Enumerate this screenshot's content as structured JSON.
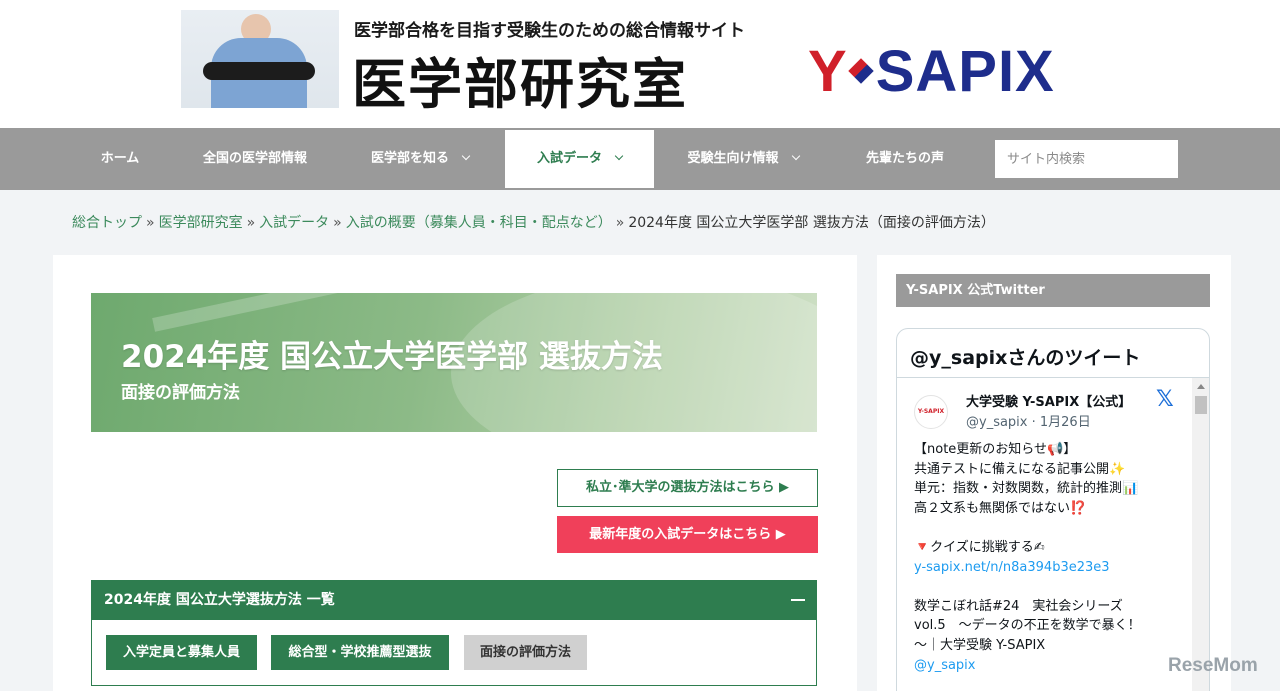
{
  "header": {
    "tagline": "医学部合格を目指す受験生のための総合情報サイト",
    "logo_text": "医学部研究室",
    "brand_y": "Y",
    "brand_rest": "SAPIX"
  },
  "nav": {
    "items": [
      {
        "label": "ホーム",
        "dropdown": false
      },
      {
        "label": "全国の医学部情報",
        "dropdown": false
      },
      {
        "label": "医学部を知る",
        "dropdown": true
      },
      {
        "label": "入試データ",
        "dropdown": true,
        "active": true
      },
      {
        "label": "受験生向け情報",
        "dropdown": true
      },
      {
        "label": "先輩たちの声",
        "dropdown": false
      }
    ],
    "search_placeholder": "サイト内検索"
  },
  "breadcrumb": {
    "items": [
      "総合トップ",
      "医学部研究室",
      "入試データ",
      "入試の概要（募集人員・科目・配点など）"
    ],
    "current": "2024年度 国公立大学医学部 選抜方法（面接の評価方法）",
    "separator": "»"
  },
  "main": {
    "banner_title": "2024年度 国公立大学医学部 選抜方法",
    "banner_subtitle": "面接の評価方法",
    "private_link": "私立･準大学の選抜方法はこちら ▶",
    "latest_link": "最新年度の入試データはこちら ▶",
    "accordion_title": "2024年度 国公立大学選抜方法 一覧",
    "tags": [
      "入学定員と募集人員",
      "総合型・学校推薦型選抜",
      "面接の評価方法"
    ]
  },
  "sidebar": {
    "heading": "Y-SAPIX 公式Twitter",
    "timeline_title": "@y_sapixさんのツイート",
    "tweet": {
      "avatar_text": "Y-SAPIX",
      "name": "大学受験 Y-SAPIX【公式】",
      "handle_date": "@y_sapix · 1月26日",
      "lines": [
        "【note更新のお知らせ📢】",
        "共通テストに備えになる記事公開✨",
        "単元：指数・対数関数，統計的推測📊",
        "高２文系も無関係ではない⁉️",
        "",
        "🔻クイズに挑戦する✍",
        "y-sapix.net/n/n8a394b3e23e3",
        "",
        "数学こぼれ話#24　実社会シリーズ",
        "vol.5　～データの不正を数学で暴く！",
        "～｜大学受験 Y-SAPIX",
        "@y_sapix"
      ]
    }
  },
  "watermark": "ReseMom",
  "colors": {
    "green": "#2e7d4f",
    "red_button": "#f0405a",
    "nav_gray": "#9a9a9a",
    "link": "#1d9bf0"
  }
}
